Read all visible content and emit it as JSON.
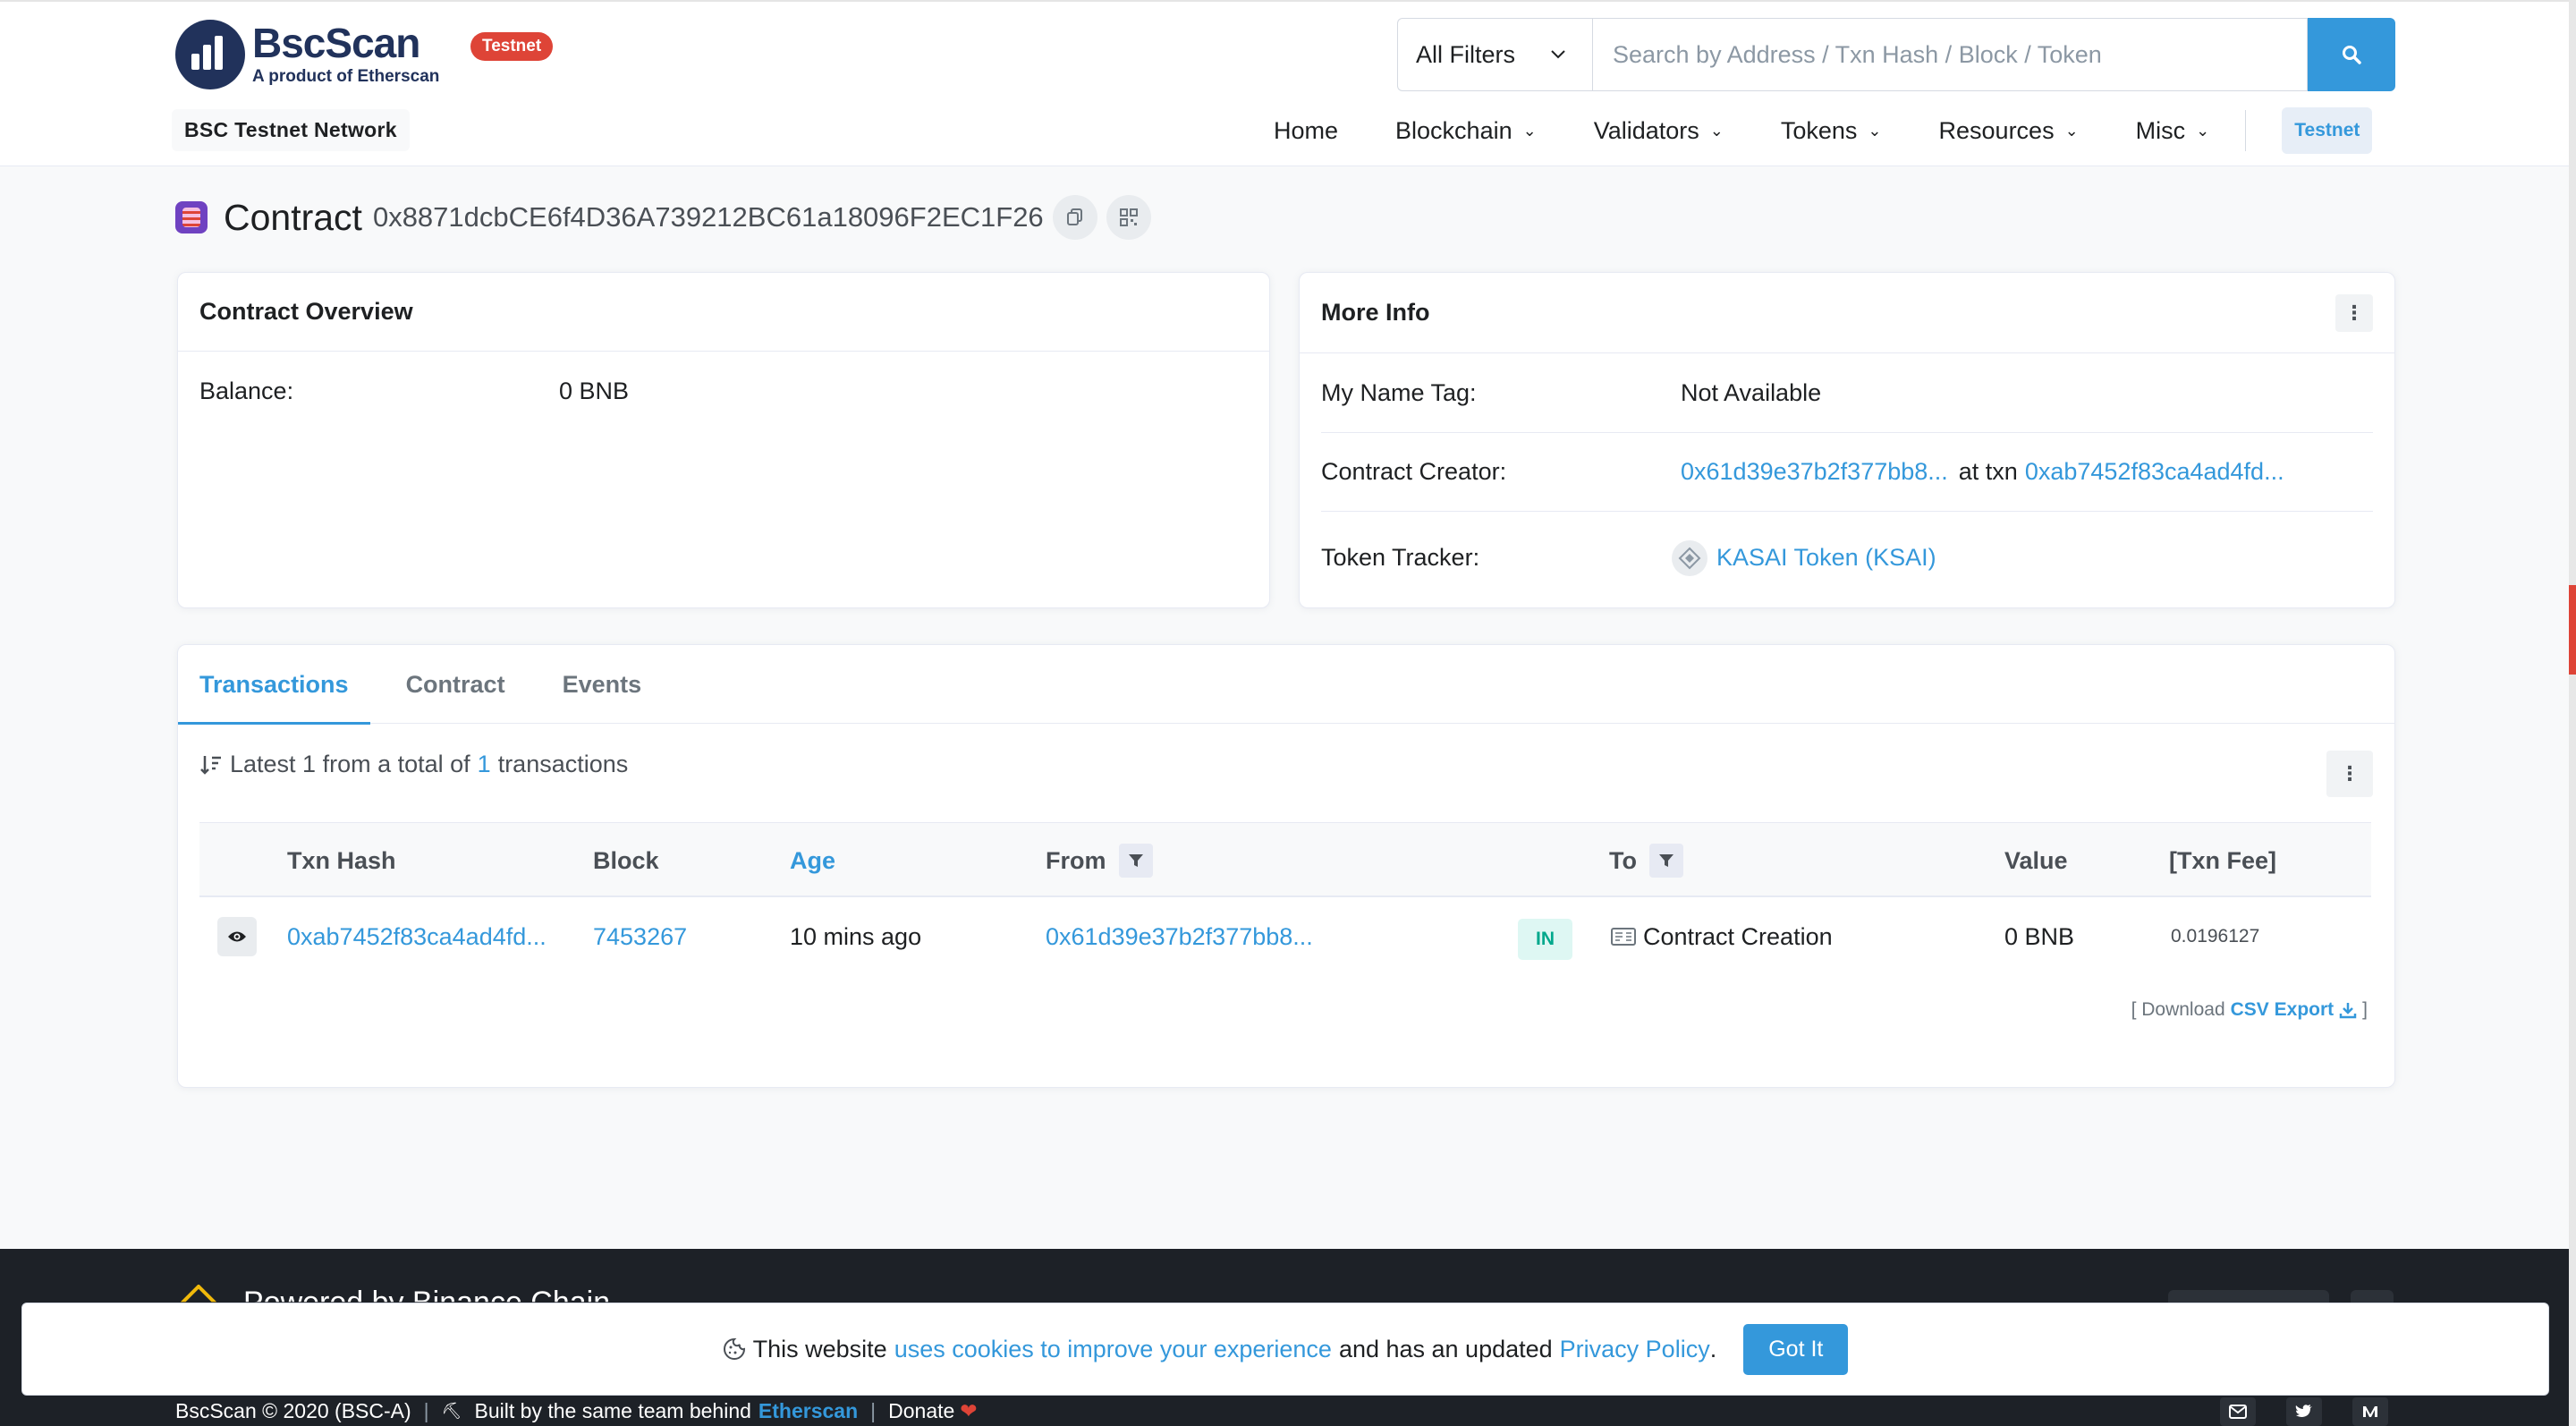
{
  "header": {
    "brand": "BscScan",
    "brand_sub": "A product of Etherscan",
    "badge": "Testnet",
    "network": "BSC Testnet Network",
    "search_filter": "All Filters",
    "search_placeholder": "Search by Address / Txn Hash / Block / Token",
    "nav": [
      "Home",
      "Blockchain",
      "Validators",
      "Tokens",
      "Resources",
      "Misc"
    ],
    "nav_network": "Testnet"
  },
  "title": {
    "label": "Contract",
    "address": "0x8871dcbCE6f4D36A739212BC61a18096F2EC1F26"
  },
  "overview": {
    "heading": "Contract Overview",
    "balance_label": "Balance:",
    "balance_value": "0 BNB"
  },
  "more_info": {
    "heading": "More Info",
    "name_tag_label": "My Name Tag:",
    "name_tag_value": "Not Available",
    "creator_label": "Contract Creator:",
    "creator_address": "0x61d39e37b2f377bb8...",
    "creator_at": "at txn",
    "creator_txn": "0xab7452f83ca4ad4fd...",
    "tracker_label": "Token Tracker:",
    "tracker_value": "KASAI Token (KSAI)"
  },
  "tabs": [
    "Transactions",
    "Contract",
    "Events"
  ],
  "summary": {
    "prefix": "Latest 1 from a total of",
    "count": "1",
    "suffix": "transactions"
  },
  "table": {
    "headers": [
      "Txn Hash",
      "Block",
      "Age",
      "From",
      "To",
      "Value",
      "[Txn Fee]"
    ],
    "rows": [
      {
        "hash": "0xab7452f83ca4ad4fd...",
        "block": "7453267",
        "age": "10 mins ago",
        "from": "0x61d39e37b2f377bb8...",
        "direction": "IN",
        "to": "Contract Creation",
        "value": "0 BNB",
        "fee": "0.0196127"
      }
    ]
  },
  "download": {
    "open": "[ Download",
    "link": "CSV Export",
    "close": "]"
  },
  "footer": {
    "partial_heading": "Powered by Binance Chain",
    "copyright": "BscScan © 2020 (BSC-A)",
    "built": "Built by the same team behind",
    "built_link": "Etherscan",
    "donate": "Donate"
  },
  "cookie": {
    "text_1": "This website",
    "link_1": "uses cookies to improve your experience",
    "text_2": "and has an updated",
    "link_2": "Privacy Policy",
    "text_3": ".",
    "button": "Got It"
  },
  "colors": {
    "primary": "#3498db",
    "success": "#00c9a7",
    "danger": "#de4437",
    "brand_dark": "#21325b",
    "brand_gold": "#f0b90b"
  }
}
